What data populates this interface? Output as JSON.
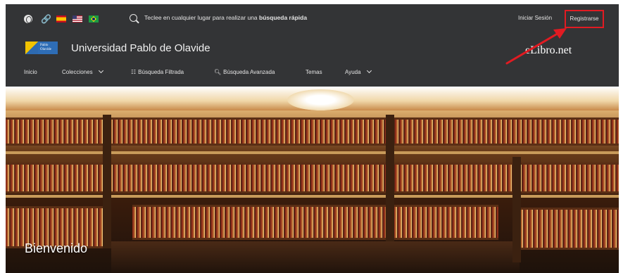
{
  "topbar": {
    "icons": [
      "globe-icon",
      "link-icon",
      "flag-es-icon",
      "flag-us-icon",
      "flag-br-icon"
    ],
    "search_prefix": "Teclee en cualquier lugar para realizar una",
    "search_bold": "búsqueda rápida",
    "login_label": "Iniciar Sesión",
    "register_label": "Registrarse",
    "register_highlight_color": "#e11b22"
  },
  "brand": {
    "logo_text": "Pablo Olavide",
    "university_name": "Universidad Pablo de Olavide",
    "product_name": "eLibro.net"
  },
  "nav": {
    "items": [
      {
        "label": "Inicio",
        "icon": null,
        "dropdown": false
      },
      {
        "label": "Colecciones",
        "icon": null,
        "dropdown": true
      },
      {
        "label": "Búsqueda Filtrada",
        "icon": "filter-icon",
        "dropdown": false
      },
      {
        "label": "Búsqueda Avanzada",
        "icon": "search-icon",
        "dropdown": false
      },
      {
        "label": "Temas",
        "icon": null,
        "dropdown": false
      },
      {
        "label": "Ayuda",
        "icon": null,
        "dropdown": true
      }
    ]
  },
  "hero": {
    "welcome": "Bienvenido",
    "image": "library-interior-photo"
  },
  "colors": {
    "header_bg": "#333436",
    "text": "#e4e4e4",
    "annotation_arrow": "#e11b22"
  }
}
